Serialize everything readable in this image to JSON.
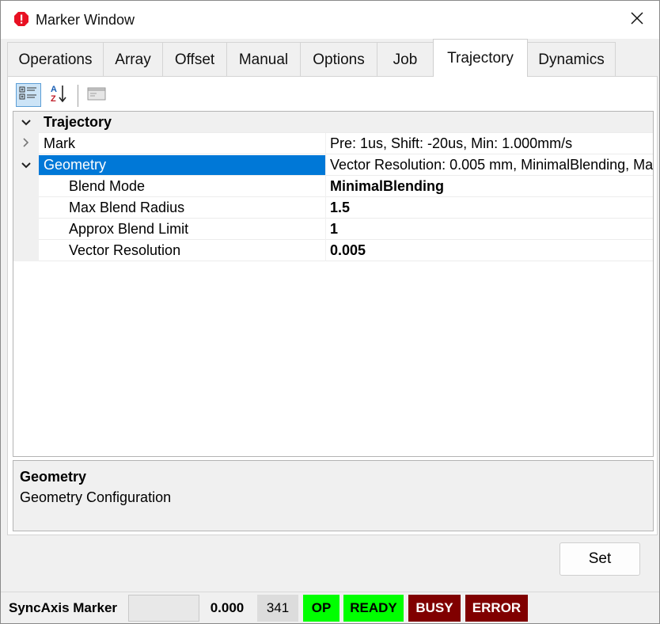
{
  "window": {
    "title": "Marker Window",
    "app_icon": "error-shield-icon",
    "close_icon": "close-icon"
  },
  "tabs": [
    {
      "label": "Operations"
    },
    {
      "label": "Array"
    },
    {
      "label": "Offset"
    },
    {
      "label": "Manual"
    },
    {
      "label": "Options"
    },
    {
      "label": "Job"
    },
    {
      "label": "Trajectory",
      "active": true
    },
    {
      "label": "Dynamics"
    }
  ],
  "toolbar": {
    "categorized_icon": "categorized-view-icon",
    "alphabetical_icon": "sort-alphabetical-icon",
    "property_pages_icon": "property-pages-icon"
  },
  "grid": {
    "category": {
      "label": "Trajectory"
    },
    "rows": [
      {
        "label": "Mark",
        "value": "Pre: 1us, Shift: -20us, Min: 1.000mm/s"
      },
      {
        "label": "Geometry",
        "value": "Vector Resolution: 0.005 mm, MinimalBlending, Max"
      },
      {
        "label": "Blend Mode",
        "value": "MinimalBlending"
      },
      {
        "label": "Max Blend Radius",
        "value": "1.5"
      },
      {
        "label": "Approx Blend Limit",
        "value": "1"
      },
      {
        "label": "Vector Resolution",
        "value": "0.005"
      }
    ]
  },
  "description": {
    "title": "Geometry",
    "text": "Geometry Configuration"
  },
  "buttons": {
    "set_label": "Set"
  },
  "status": {
    "app_name": "SyncAxis Marker",
    "value": "0.000",
    "count": "341",
    "op": "OP",
    "ready": "READY",
    "busy": "BUSY",
    "error": "ERROR"
  },
  "colors": {
    "selection": "#0078d7",
    "op_bg": "#00ff00",
    "ready_bg": "#00ff00",
    "busy_bg": "#800000",
    "error_bg": "#800000"
  }
}
